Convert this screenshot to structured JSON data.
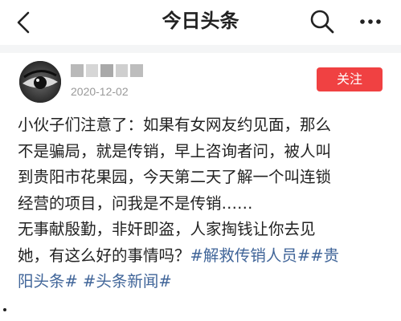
{
  "header": {
    "title": "今日头条",
    "icons": [
      "back-icon",
      "search-icon",
      "more-icon"
    ]
  },
  "author": {
    "date": "2020-12-02",
    "follow_label": "关注"
  },
  "post": {
    "lines": [
      "小伙子们注意了：如果有女网友约见面，那么",
      "不是骗局，就是传销，早上咨询者问，被人叫",
      "到贵阳市花果园，今天第二天了解一个叫连锁",
      "经营的项目，问我是不是传销……",
      "无事献殷勤，非奸即盗，人家掏钱让你去见"
    ],
    "line6_text": "她，有这么好的事情吗？",
    "hashtags": [
      "#解救传销人员#",
      "#贵阳头条#",
      "#头条新闻#"
    ]
  },
  "colors": {
    "accent_red": "#f04142",
    "link_blue": "#406599",
    "date_gray": "#999999"
  }
}
